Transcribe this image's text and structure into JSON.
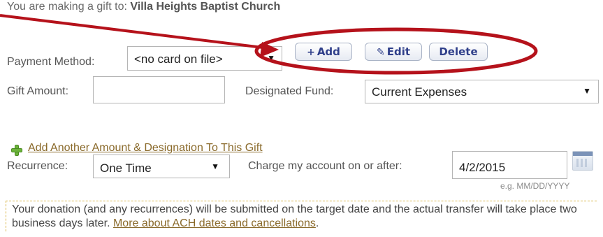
{
  "gift": {
    "prefix": "You are making a gift to: ",
    "church": "Villa Heights Baptist Church"
  },
  "payment": {
    "label": "Payment Method:",
    "selected": "<no card on file>",
    "add_label": "Add",
    "edit_label": "Edit",
    "delete_label": "Delete"
  },
  "amount": {
    "label": "Gift Amount:",
    "value": ""
  },
  "fund": {
    "label": "Designated Fund:",
    "selected": "Current Expenses"
  },
  "add_another": {
    "label": "Add Another Amount & Designation To This Gift"
  },
  "recurrence": {
    "label": "Recurrence:",
    "selected": "One Time"
  },
  "charge": {
    "label": "Charge my account on or after:",
    "date_value": "4/2/2015",
    "hint": "e.g. MM/DD/YYYY"
  },
  "notice": {
    "text": "Your donation (and any recurrences) will be submitted on the target date and the actual transfer will take place two business days later. ",
    "link": "More about ACH dates and cancellations",
    "end": "."
  },
  "icons": {
    "add": "plus-icon",
    "edit": "pencil-icon",
    "add_another": "green-plus-icon",
    "calendar": "calendar-icon",
    "dropdown": "chevron-down-icon"
  },
  "colors": {
    "highlight_annotation": "#b5121b",
    "link": "#8a6a2b",
    "button_text": "#2f3f8a",
    "notice_border": "#d9b64a"
  }
}
